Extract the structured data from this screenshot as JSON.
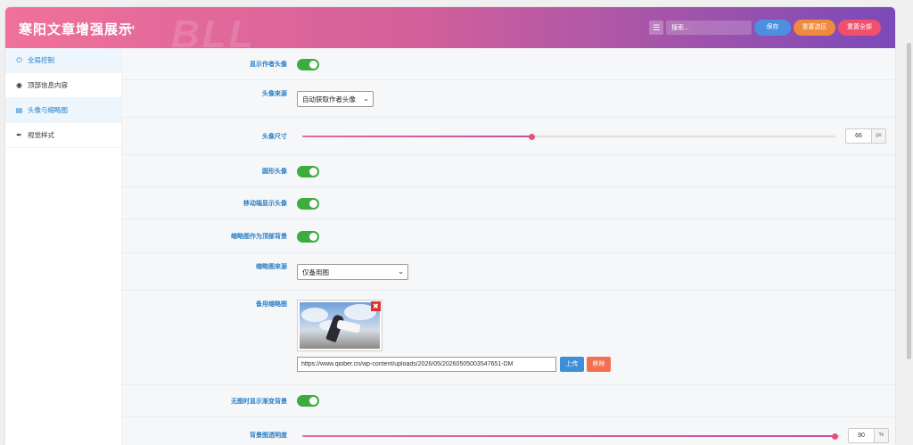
{
  "header": {
    "title": "寒阳文章增强展示",
    "version": "v1.0.4",
    "watermark": "BLL",
    "menu_icon": "list-icon",
    "search_placeholder": "搜索...",
    "save_label": "保存",
    "reset_section_label": "重置选区",
    "reset_all_label": "重置全部",
    "colors": {
      "gradient_start": "#f0719a",
      "gradient_end": "#7b4ab8",
      "save": "#4c8fe0",
      "reset_section": "#f08a3c",
      "reset_all": "#f0506e"
    }
  },
  "sidebar": {
    "items": [
      {
        "label": "全局控制",
        "icon": "power-icon",
        "state": "active"
      },
      {
        "label": "顶部信息内容",
        "icon": "eye-icon",
        "state": "normal"
      },
      {
        "label": "头像与缩略图",
        "icon": "image-icon",
        "state": "highlighted"
      },
      {
        "label": "视觉样式",
        "icon": "brush-icon",
        "state": "normal"
      }
    ]
  },
  "settings": {
    "show_author_avatar": {
      "label": "显示作者头像",
      "enabled": true
    },
    "avatar_source": {
      "label": "头像来源",
      "value": "自动获取作者头像"
    },
    "avatar_size": {
      "label": "头像尺寸",
      "value": "66",
      "unit": "px",
      "fill_fraction": 0.43
    },
    "round_avatar": {
      "label": "圆形头像",
      "enabled": true
    },
    "mobile_show_avatar": {
      "label": "移动端显示头像",
      "enabled": true
    },
    "thumb_as_top_bg": {
      "label": "缩略图作为顶部背景",
      "enabled": true
    },
    "thumb_source": {
      "label": "缩略图来源",
      "value": "仅备用图"
    },
    "fallback_thumb": {
      "label": "备用缩略图",
      "url": "https://www.qiober.cn/wp-content/uploads/2026/05/20260505003547651-DM",
      "upload_label": "上传",
      "remove_label": "移除",
      "delete_icon": "close-icon"
    },
    "no_image_gradient_bg": {
      "label": "无图时显示渐变背景",
      "enabled": true
    },
    "bg_opacity": {
      "label": "背景图透明度",
      "value": "90",
      "unit": "%",
      "fill_fraction": 0.99
    }
  },
  "accent_color": "#2a7fc5",
  "toggle_color": "#3eab3e"
}
